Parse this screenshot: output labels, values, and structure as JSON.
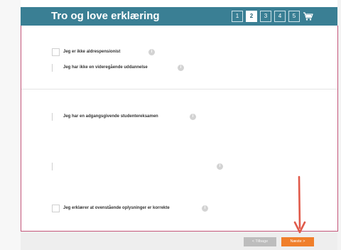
{
  "header": {
    "title": "Tro og love erklæring",
    "steps": [
      "1",
      "2",
      "3",
      "4",
      "5"
    ],
    "active_step": "2",
    "cart_icon": "cart-icon"
  },
  "sections": [
    {
      "question": "",
      "options": [
        {
          "label": "Jeg er ikke aldrespensionist",
          "info_icon": "info-icon"
        },
        {
          "label": "Jeg har ikke en videregående uddannelse",
          "info_icon": "info-icon"
        }
      ]
    },
    {
      "question": "",
      "options": [
        {
          "label": "Jeg har en adgangsgivende studentereksamen",
          "info_icon": "info-icon"
        }
      ]
    },
    {
      "question": "",
      "options": [
        {
          "label": "",
          "info_icon": "info-icon"
        }
      ]
    },
    {
      "question": "",
      "options": [
        {
          "label": "Jeg erklærer at ovenstående oplysninger er korrekte",
          "info_icon": "info-icon"
        }
      ]
    }
  ],
  "footer": {
    "back_label": "< Tilbage",
    "next_label": "Næste >"
  },
  "colors": {
    "header_bg": "#3a7f94",
    "panel_border": "#c4567a",
    "next_button": "#f07f2b",
    "back_button": "#bdbdbd",
    "annotation_arrow": "#e05a4a"
  }
}
